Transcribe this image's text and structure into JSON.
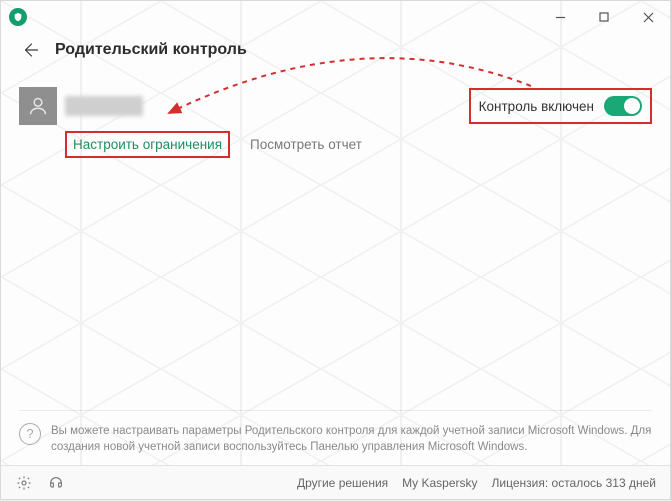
{
  "header": {
    "title": "Родительский контроль"
  },
  "user": {
    "control_label": "Контроль включен",
    "configure_link": "Настроить ограничения",
    "report_link": "Посмотреть отчет"
  },
  "tip": {
    "text": "Вы можете настраивать параметры Родительского контроля для каждой учетной записи Microsoft Windows. Для создания новой учетной записи воспользуйтесь Панелью управления Microsoft Windows."
  },
  "bottombar": {
    "other_solutions": "Другие решения",
    "my_kaspersky": "My Kaspersky",
    "license": "Лицензия: осталось 313 дней"
  },
  "colors": {
    "accent": "#1aa877",
    "annotation": "#d32e2e"
  }
}
